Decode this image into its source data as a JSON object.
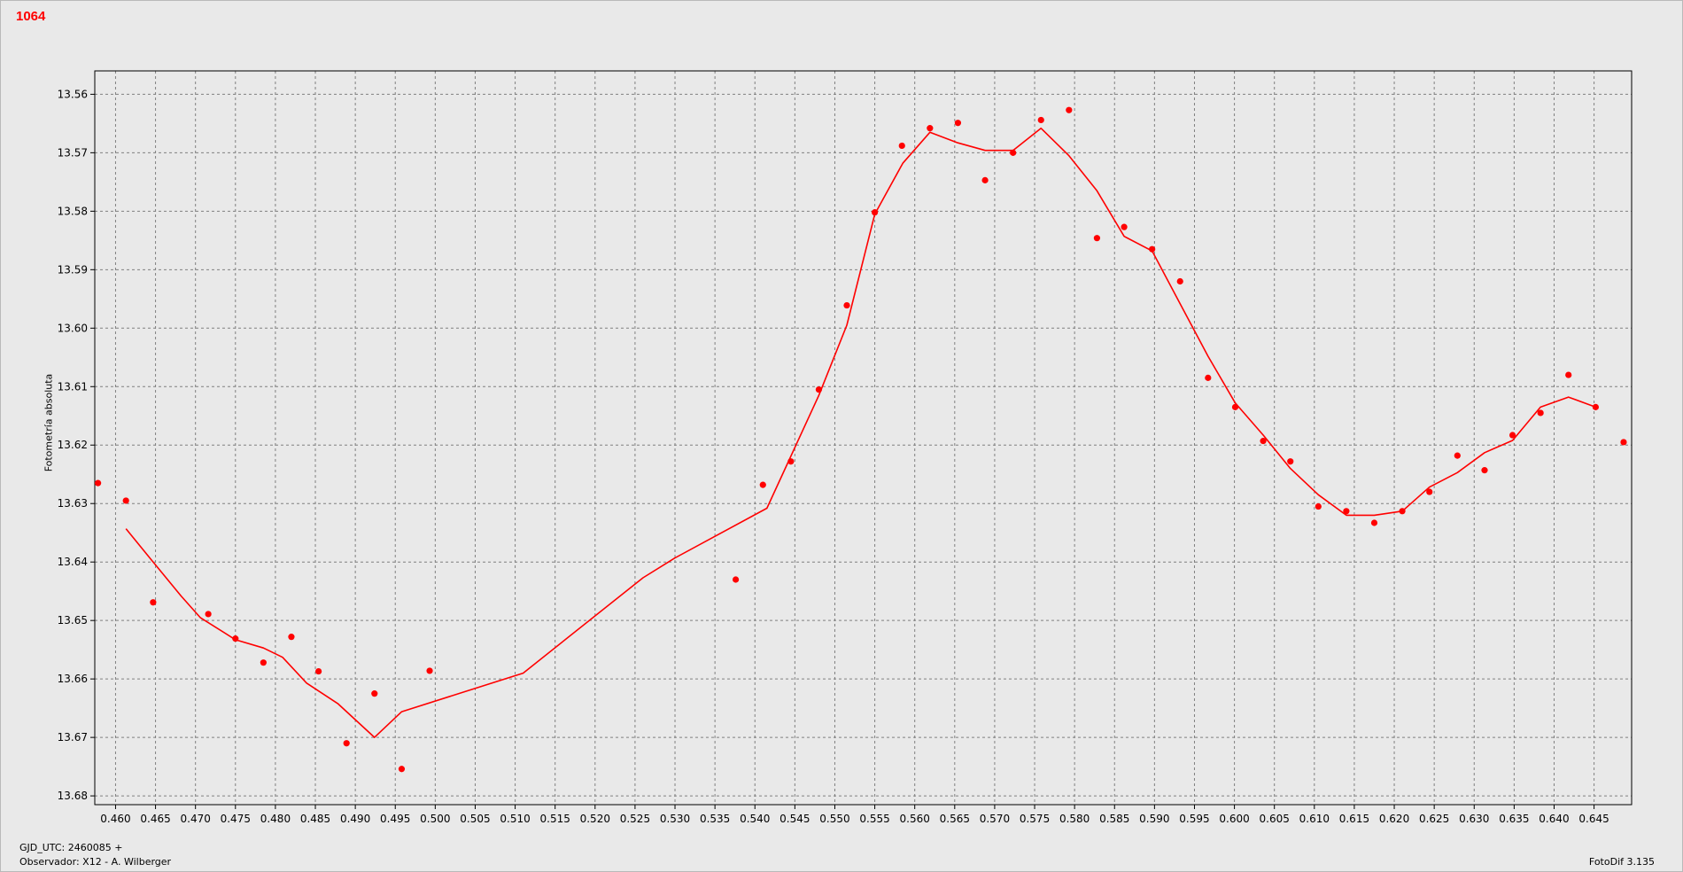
{
  "chart_data": {
    "type": "scatter",
    "title": "1064",
    "ylabel": "Fotometría absoluta",
    "xlim": [
      0.4574,
      0.6497
    ],
    "ylim": [
      13.556,
      13.6815
    ],
    "y_inverted": true,
    "grid": true,
    "x_ticks": [
      "0.460",
      "0.465",
      "0.470",
      "0.475",
      "0.480",
      "0.485",
      "0.490",
      "0.495",
      "0.500",
      "0.505",
      "0.510",
      "0.515",
      "0.520",
      "0.525",
      "0.530",
      "0.535",
      "0.540",
      "0.545",
      "0.550",
      "0.555",
      "0.560",
      "0.565",
      "0.570",
      "0.575",
      "0.580",
      "0.585",
      "0.590",
      "0.595",
      "0.600",
      "0.605",
      "0.610",
      "0.615",
      "0.620",
      "0.625",
      "0.630",
      "0.635",
      "0.640",
      "0.645"
    ],
    "y_ticks": [
      "13.56",
      "13.57",
      "13.58",
      "13.59",
      "13.60",
      "13.61",
      "13.62",
      "13.63",
      "13.64",
      "13.65",
      "13.66",
      "13.67",
      "13.68"
    ],
    "colors": {
      "series": "#ff0000",
      "grid": "#808080",
      "background": "#e9e9e9"
    },
    "series": [
      {
        "type": "scatter",
        "x": [
          0.4578,
          0.4613,
          0.4647,
          0.4716,
          0.475,
          0.4785,
          0.482,
          0.4854,
          0.4889,
          0.4924,
          0.4958,
          0.4993,
          0.5376,
          0.541,
          0.5445,
          0.548,
          0.5515,
          0.555,
          0.5584,
          0.5619,
          0.5654,
          0.5688,
          0.5723,
          0.5758,
          0.5793,
          0.5828,
          0.5862,
          0.5897,
          0.5932,
          0.5967,
          0.6001,
          0.6036,
          0.607,
          0.6105,
          0.614,
          0.6175,
          0.621,
          0.6244,
          0.6279,
          0.6313,
          0.6348,
          0.6383,
          0.6418,
          0.6452,
          0.6487
        ],
        "y": [
          13.6265,
          13.6295,
          13.6469,
          13.6489,
          13.6531,
          13.6572,
          13.6528,
          13.6587,
          13.671,
          13.6625,
          13.6754,
          13.6586,
          13.643,
          13.6268,
          13.6228,
          13.6105,
          13.5961,
          13.5802,
          13.5688,
          13.5658,
          13.5649,
          13.5747,
          13.57,
          13.5644,
          13.5627,
          13.5846,
          13.5827,
          13.5865,
          13.592,
          13.6085,
          13.6135,
          13.6193,
          13.6228,
          13.6305,
          13.6313,
          13.6333,
          13.6313,
          13.628,
          13.6218,
          13.6243,
          13.6183,
          13.6145,
          13.608,
          13.6135,
          13.6195
        ]
      },
      {
        "type": "line",
        "x": [
          0.4613,
          0.4647,
          0.4682,
          0.4706,
          0.475,
          0.4785,
          0.4809,
          0.4839,
          0.4878,
          0.4924,
          0.4958,
          0.511,
          0.526,
          0.53,
          0.5415,
          0.548,
          0.5515,
          0.555,
          0.5585,
          0.5619,
          0.5654,
          0.5688,
          0.5723,
          0.5758,
          0.5793,
          0.5828,
          0.5862,
          0.5897,
          0.5932,
          0.5967,
          0.6001,
          0.6036,
          0.607,
          0.6105,
          0.614,
          0.6175,
          0.621,
          0.6244,
          0.6279,
          0.6313,
          0.6348,
          0.6383,
          0.6418,
          0.6452
        ],
        "y": [
          13.6343,
          13.64,
          13.6458,
          13.6495,
          13.6533,
          13.6547,
          13.6563,
          13.6607,
          13.6642,
          13.67,
          13.6656,
          13.659,
          13.6427,
          13.6393,
          13.6308,
          13.6115,
          13.5995,
          13.5805,
          13.5718,
          13.5665,
          13.5683,
          13.5696,
          13.5696,
          13.5658,
          13.5705,
          13.5765,
          13.5843,
          13.5868,
          13.5958,
          13.6048,
          13.6128,
          13.6183,
          13.624,
          13.6285,
          13.632,
          13.632,
          13.6313,
          13.6272,
          13.6247,
          13.6213,
          13.6192,
          13.6135,
          13.6118,
          13.6135
        ]
      }
    ]
  },
  "footer": {
    "line1": "GJD_UTC: 2460085 +",
    "line2": "Observador: X12 - A. Wilberger",
    "software": "FotoDif 3.135"
  }
}
